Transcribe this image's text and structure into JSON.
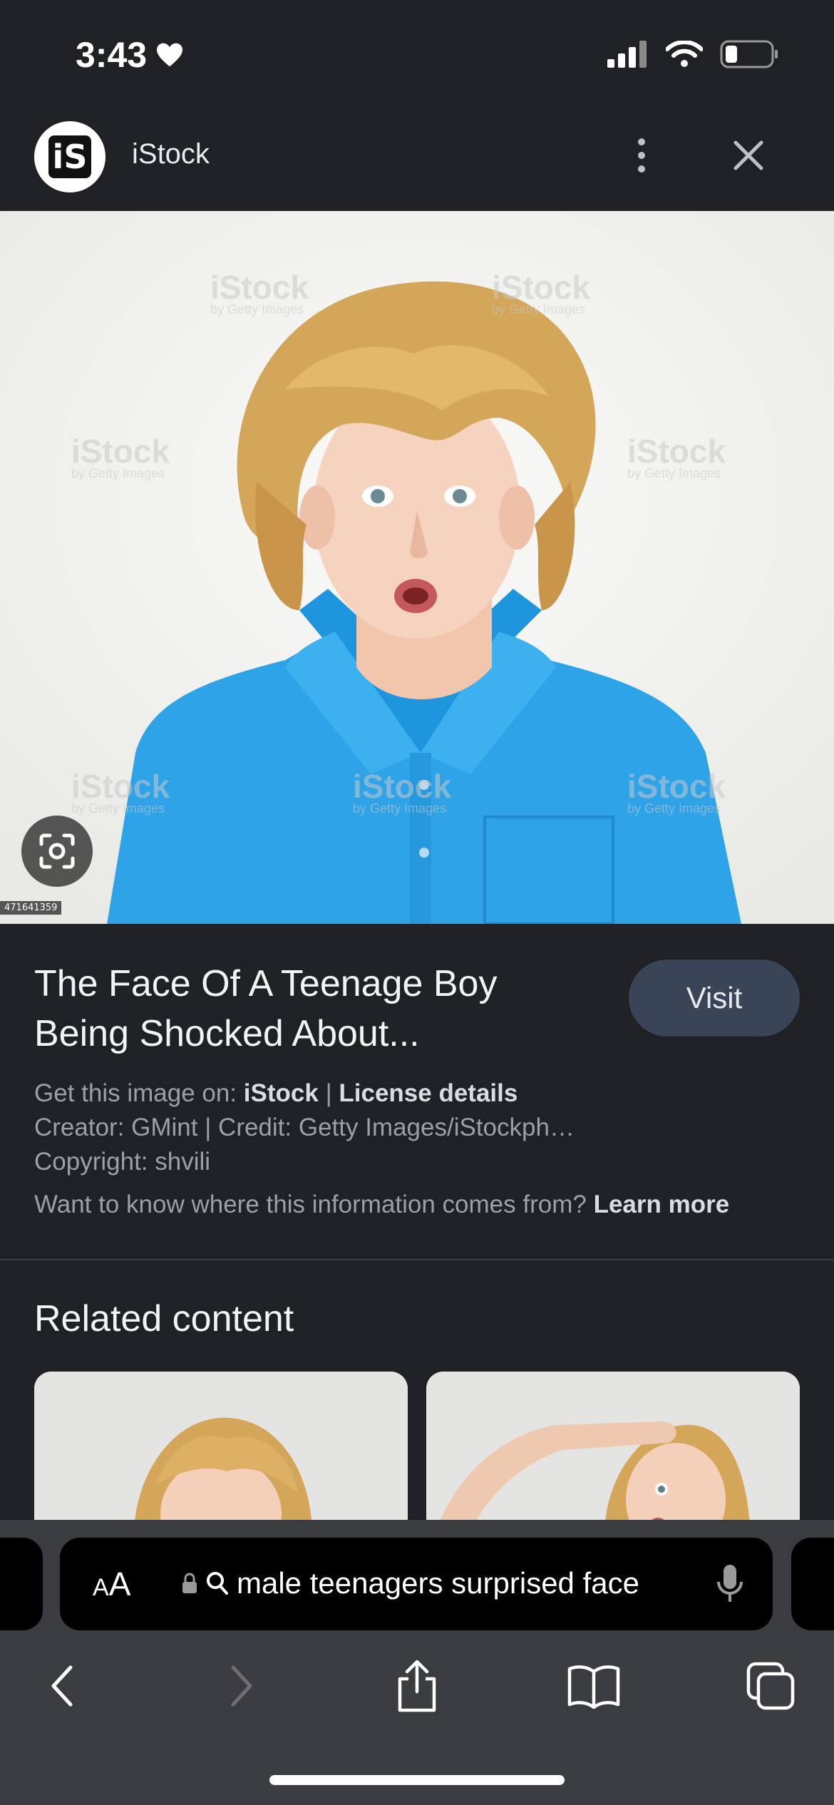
{
  "status_bar": {
    "time": "3:43"
  },
  "header": {
    "site_name": "iStock",
    "logo_text": "iS"
  },
  "image": {
    "id_label": "471641359",
    "watermark": "iStock",
    "watermark_sub": "by Getty Images"
  },
  "result": {
    "title": "The Face Of A Teenage Boy Being Shocked About...",
    "visit_label": "Visit",
    "get_image_prefix": "Get this image on:",
    "get_image_source": "iStock",
    "separator": "|",
    "license_label": "License details",
    "creator_line": "Creator: GMint | Credit: Getty Images/iStockph…",
    "copyright_line": "Copyright: shvili",
    "info_question": "Want to know where this information comes from?",
    "learn_more": "Learn more"
  },
  "related": {
    "title": "Related content"
  },
  "address_bar": {
    "text_size_label": "AA",
    "query": "male teenagers surprised face"
  },
  "colors": {
    "background": "#202124",
    "visit_button": "#394457",
    "toolbar": "#3b3c3f",
    "shirt": "#2ea3e8"
  }
}
